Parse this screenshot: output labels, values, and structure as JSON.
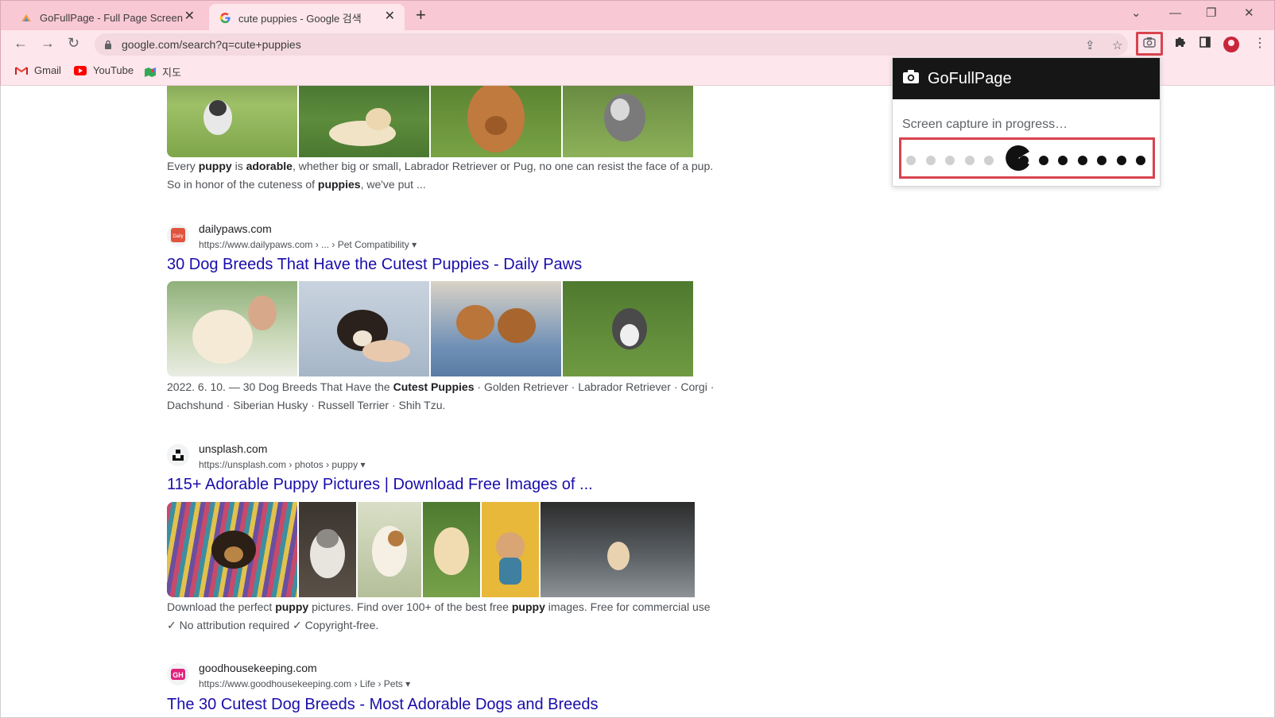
{
  "browser": {
    "tabs": [
      {
        "title": "GoFullPage - Full Page Screen Capture",
        "favicon": "gofullpage-favicon",
        "active": false
      },
      {
        "title": "cute puppies - Google 검색",
        "favicon": "google-favicon",
        "active": true
      }
    ],
    "address": "google.com/search?q=cute+puppies",
    "bookmarks": [
      {
        "label": "Gmail",
        "icon": "gmail-icon"
      },
      {
        "label": "YouTube",
        "icon": "youtube-icon"
      },
      {
        "label": "지도",
        "icon": "maps-icon"
      }
    ]
  },
  "popup": {
    "title": "GoFullPage",
    "status": "Screen capture in progress…",
    "progress_dots_done": 5,
    "progress_dots_remaining": 7,
    "accent": "#d9434f"
  },
  "results": [
    {
      "snippet_parts": [
        {
          "t": "Every ",
          "b": false
        },
        {
          "t": "puppy",
          "b": true
        },
        {
          "t": " is ",
          "b": false
        },
        {
          "t": "adorable",
          "b": true
        },
        {
          "t": ", whether big or small, Labrador Retriever or Pug, no one can resist the face of a pup. So in honor of the cuteness of ",
          "b": false
        },
        {
          "t": "puppies",
          "b": true
        },
        {
          "t": ", we've put ...",
          "b": false
        }
      ]
    },
    {
      "site": "dailypaws.com",
      "cite": "https://www.dailypaws.com › ... › Pet Compatibility",
      "title": "30 Dog Breeds That Have the Cutest Puppies - Daily Paws",
      "snippet_parts": [
        {
          "t": "2022. 6. 10. — 30 Dog Breeds That Have the ",
          "b": false
        },
        {
          "t": "Cutest Puppies",
          "b": true
        },
        {
          "t": " · Golden Retriever · Labrador Retriever · Corgi · Dachshund · Siberian Husky · Russell Terrier · Shih Tzu.",
          "b": false
        }
      ]
    },
    {
      "site": "unsplash.com",
      "cite": "https://unsplash.com › photos › puppy",
      "title": "115+ Adorable Puppy Pictures | Download Free Images of ...",
      "snippet_parts": [
        {
          "t": "Download the perfect ",
          "b": false
        },
        {
          "t": "puppy",
          "b": true
        },
        {
          "t": " pictures. Find over 100+ of the best free ",
          "b": false
        },
        {
          "t": "puppy",
          "b": true
        },
        {
          "t": " images. Free for commercial use ✓ No attribution required ✓ Copyright-free.",
          "b": false
        }
      ]
    },
    {
      "site": "goodhousekeeping.com",
      "cite": "https://www.goodhousekeeping.com › Life › Pets",
      "title": "The 30 Cutest Dog Breeds - Most Adorable Dogs and Breeds"
    }
  ],
  "theme": {
    "tabstrip": "#f9c8d5",
    "toolbar": "#fde6ec",
    "link": "#1a0dab"
  }
}
